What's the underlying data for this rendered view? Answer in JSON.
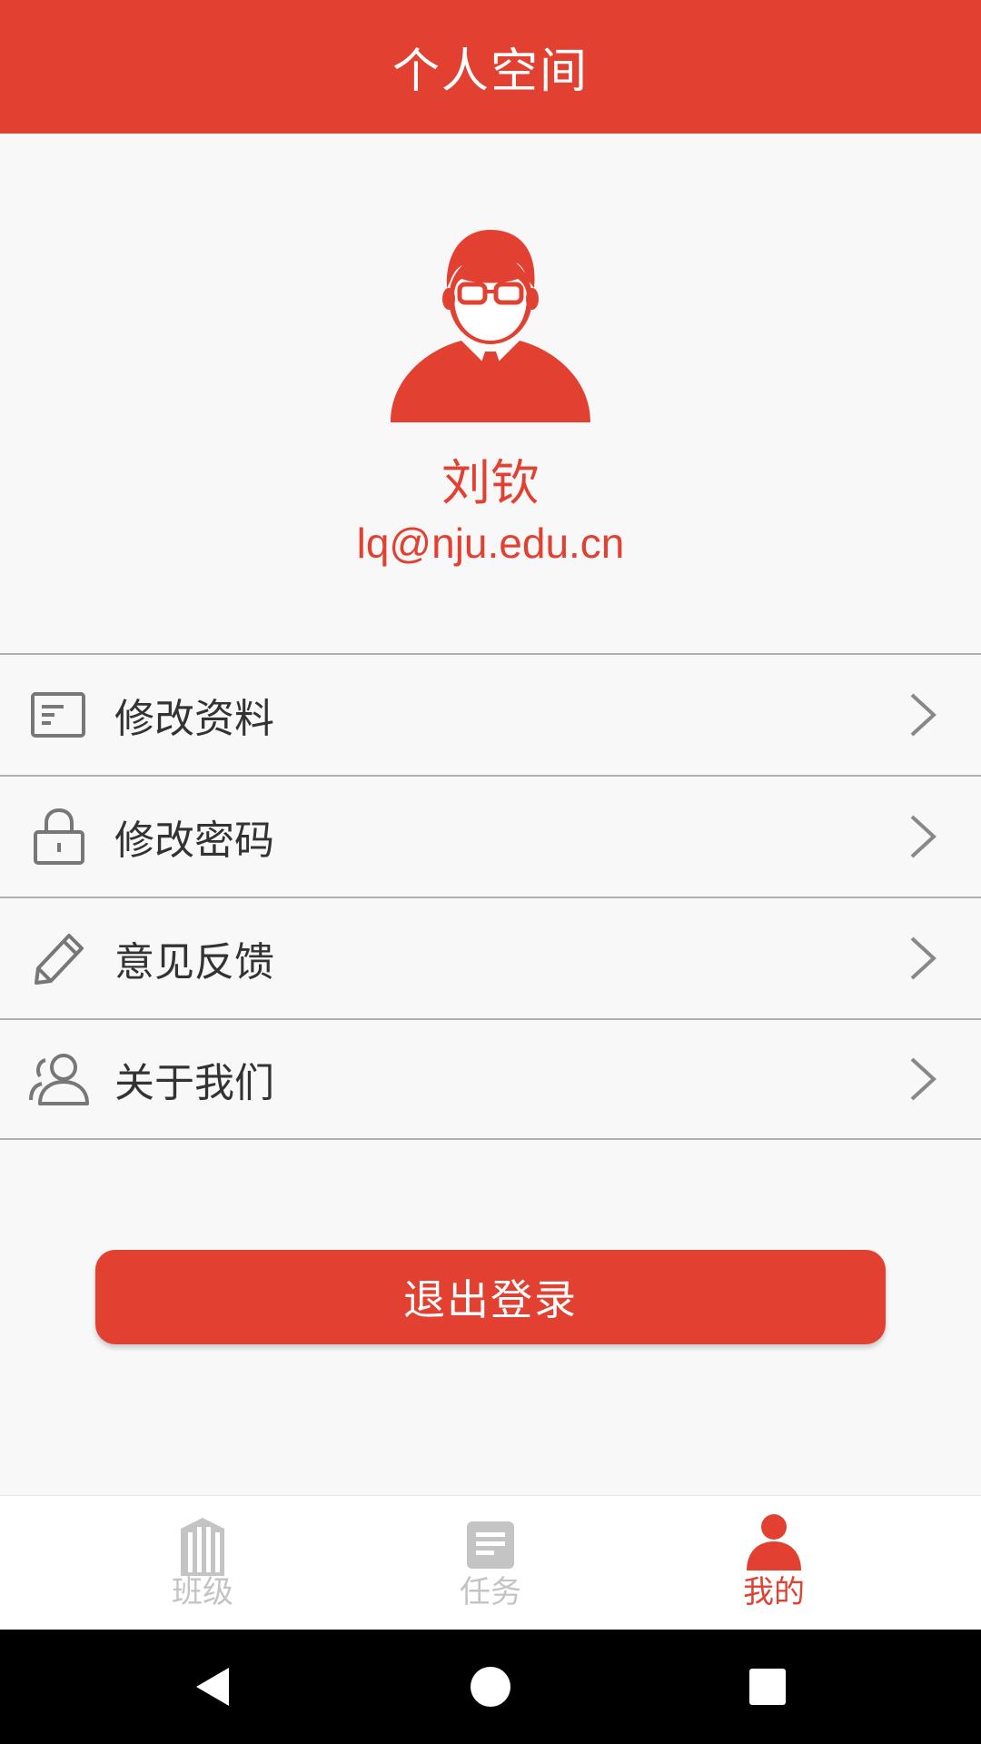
{
  "app_bar": {
    "title": "个人空间"
  },
  "profile": {
    "name": "刘钦",
    "email": "lq@nju.edu.cn",
    "avatar_icon": "user-avatar-icon"
  },
  "menu": {
    "items": [
      {
        "label": "修改资料",
        "icon": "profile-card-icon"
      },
      {
        "label": "修改密码",
        "icon": "lock-icon"
      },
      {
        "label": "意见反馈",
        "icon": "pencil-icon"
      },
      {
        "label": "关于我们",
        "icon": "people-icon"
      }
    ]
  },
  "logout": {
    "label": "退出登录"
  },
  "tabbar": {
    "tabs": [
      {
        "label": "班级",
        "icon": "building-icon",
        "active": false
      },
      {
        "label": "任务",
        "icon": "document-icon",
        "active": false
      },
      {
        "label": "我的",
        "icon": "person-icon",
        "active": true
      }
    ]
  },
  "colors": {
    "accent": "#e24132",
    "inactive": "#c4c4c4",
    "divider": "#b0b0b0"
  }
}
